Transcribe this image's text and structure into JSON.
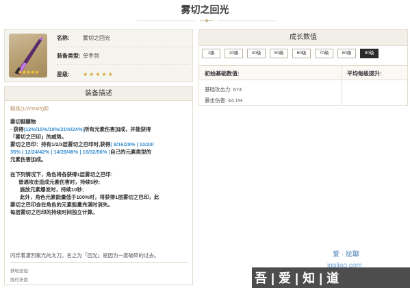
{
  "page": {
    "title": "雾切之回光"
  },
  "info": {
    "name_label": "名称:",
    "name_value": "雾切之回光",
    "type_label": "装备类型:",
    "type_value": "单手剑",
    "rarity_label": "星级:",
    "rarity_stars": "★★★★★",
    "art_stars": "★★★★★"
  },
  "description": {
    "header": "装备描述",
    "refine_label": "精炼(1/2/3/4/5)阶",
    "skill_name": "雾切御腰物",
    "line1_a": "· 获得",
    "line1_hl": "(12%/15%/18%/21%/24%)",
    "line1_b": "所有元素伤害加成，并能获得",
    "line2": "「雾切之巴印」的威势。",
    "line3_a": "雾切之巴印：持有1/2/3层雾切之巴印时,获得",
    "line3_hl1": "( 8/16/28% | 10/20/",
    "line4_hl": "35% | 12/24/42% | 14/28/49% | 16/32/56% )",
    "line4_b": "自己的元素类型的",
    "line5": "元素伤害加成。",
    "line6": "在下列情况下，角色将各获得1层雾切之巴印:",
    "line7": "普通攻击造成元素伤害时，持续5秒;",
    "line8": "施放元素爆发时，持续10秒;",
    "line9": "此外，角色元素能量低于100%时，将获得1层雾切之巴印，此",
    "line10": "雾切之巴印会在角色的元素能量充满时消失。",
    "line11": "每层雾切之巴印的持续时间独立计算。",
    "story": "闪烁着凄烈紫光的太刀。名之为「回光」是因为一度破碎的过去。",
    "source_label": "获取途径:",
    "source_value": "限时祈愿"
  },
  "growth": {
    "header": "成长数值",
    "levels": [
      "1级",
      "20级",
      "40级",
      "50级",
      "60级",
      "70级",
      "80级",
      "90级"
    ],
    "active_level": "90级",
    "base_header": "初始基础数值:",
    "avg_header": "平均每级提升:",
    "stat1": "基础攻击力: 674",
    "stat2": "暴击伤害: 44.1%"
  },
  "watermark": {
    "brand": "爱 · 尬聊",
    "site": "igaliao.com",
    "band": "吾|爱|知|道"
  },
  "colors": {
    "accent": "#3a8fd0",
    "refine": "#b88a5a",
    "star": "#d9a431"
  }
}
